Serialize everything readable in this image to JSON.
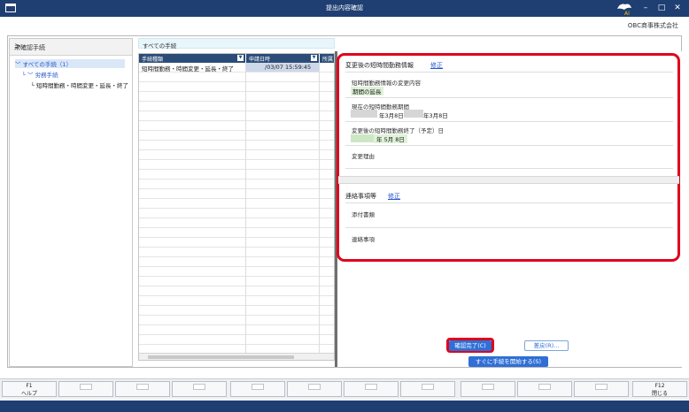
{
  "window": {
    "title": "提出内容確認",
    "company": "OBC商事株式会社",
    "minimize": "–",
    "maximize": "□",
    "close": "✕"
  },
  "left_panel": {
    "header": "未確認手続",
    "tree": [
      {
        "label": "すべての手続（1）"
      },
      {
        "label": "労務手続"
      },
      {
        "label": "短時間勤務・時間変更・延長・終了"
      }
    ]
  },
  "middle": {
    "header": "すべての手続",
    "columns": [
      "手続種類",
      "申請日時",
      "所属"
    ],
    "rows": [
      [
        "短時間勤務・時間変更・延長・終了",
        "/03/07 15:59:45",
        ""
      ]
    ]
  },
  "details": {
    "section1": {
      "title": "変更後の短時間勤務情報",
      "edit_link": "修正",
      "fields": [
        {
          "label": "短時間勤務情報の変更内容",
          "value": "期間の延長"
        },
        {
          "label": "現在の短時間勤務期間",
          "value_start": "年3月8日 〜",
          "value_end": "年3月8日"
        },
        {
          "label": "変更後の短時間勤務終了（予定）日",
          "value": "年  5月  8日"
        },
        {
          "label": "変更理由",
          "value": ""
        }
      ]
    },
    "section2": {
      "title": "連絡事項等",
      "edit_link": "修正",
      "fields": [
        {
          "label": "添付書類"
        },
        {
          "label": "連絡事項"
        }
      ]
    }
  },
  "actions": {
    "confirm": "確認完了(C)",
    "return": "差戻(R)...",
    "start": "すぐに手続を開始する(S)"
  },
  "fkeys": [
    {
      "key": "F1",
      "label": "ヘルプ"
    },
    {
      "key": "F12",
      "label": "閉じる"
    }
  ],
  "colors": {
    "titlebar": "#1f3f73",
    "accent_red": "#e0001b",
    "link": "#2255cc",
    "confirm_btn": "#2f6fd6"
  }
}
